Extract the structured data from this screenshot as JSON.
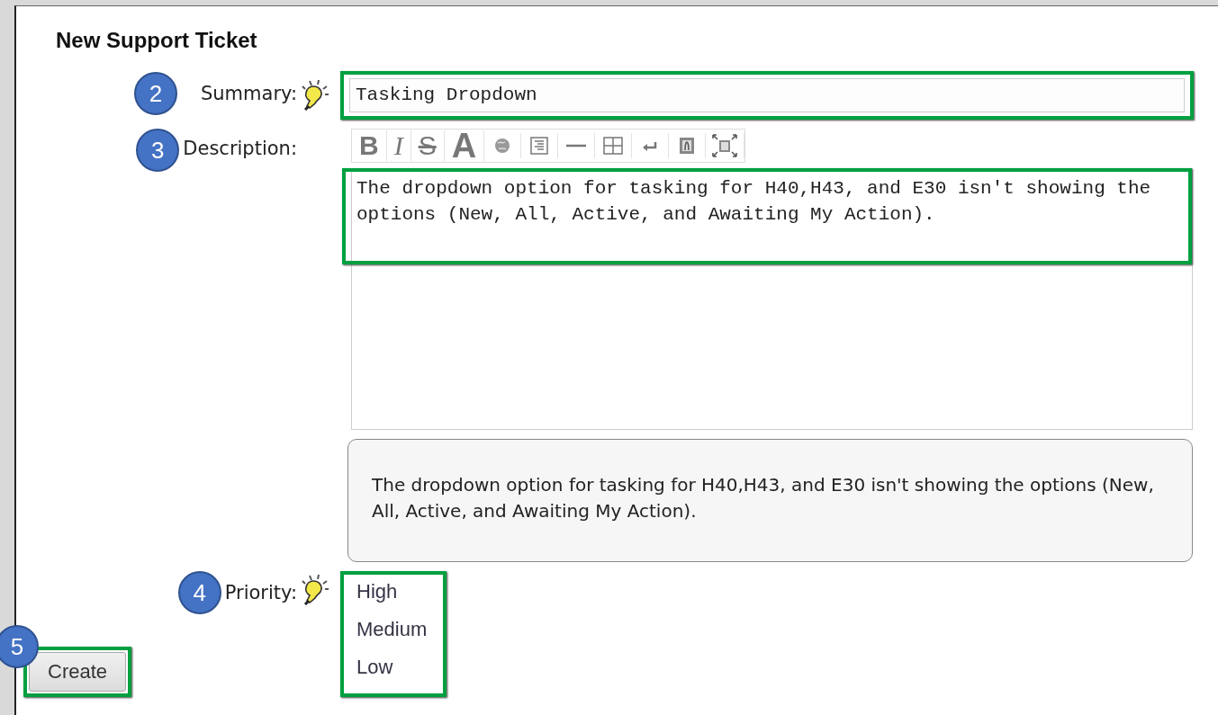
{
  "title": "New Support Ticket",
  "summary": {
    "step": "2",
    "label": "Summary:",
    "value": "Tasking Dropdown"
  },
  "description": {
    "step": "3",
    "label": "Description:",
    "toolbar": [
      {
        "kind": "bold",
        "label": "B"
      },
      {
        "kind": "italic",
        "label": "I"
      },
      {
        "kind": "strike",
        "label": "S"
      },
      {
        "kind": "font",
        "label": "A"
      },
      {
        "kind": "globe"
      },
      {
        "kind": "align"
      },
      {
        "kind": "rule"
      },
      {
        "kind": "table"
      },
      {
        "kind": "enter"
      },
      {
        "kind": "image"
      },
      {
        "kind": "fullscreen"
      }
    ],
    "value": "The dropdown option for tasking for H40,H43, and E30 isn't showing the options (New, All, Active, and Awaiting My Action).",
    "preview": "The dropdown option for tasking for H40,H43, and E30 isn't showing the options (New, All, Active, and Awaiting My Action)."
  },
  "priority": {
    "step": "4",
    "label": "Priority:",
    "options": [
      {
        "label": "High",
        "selected": false
      },
      {
        "label": "Medium",
        "selected": false
      },
      {
        "label": "Low",
        "selected": false
      }
    ]
  },
  "create": {
    "step": "5",
    "label": "Create"
  }
}
